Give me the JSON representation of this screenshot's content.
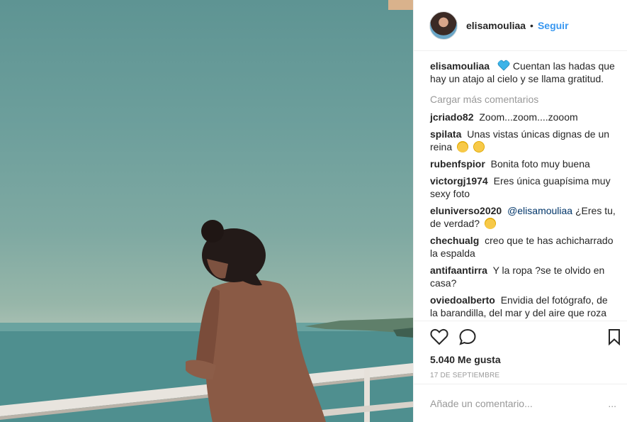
{
  "photo": {
    "alt_icon": "photo-balcony-sea"
  },
  "header": {
    "username": "elisamouliaa",
    "separator": "•",
    "follow_label": "Seguir"
  },
  "caption": {
    "username": "elisamouliaa",
    "emoji_icon": "blue-heart-icon",
    "text": "Cuentan las hadas que hay un atajo al cielo y se llama gratitud."
  },
  "load_more_label": "Cargar más comentarios",
  "comments": [
    {
      "user": "jcriado82",
      "text": "Zoom...zoom....zooom"
    },
    {
      "user": "spilata",
      "text": "Unas vistas únicas dignas de un reina",
      "emojis": [
        "scream-face-emoji",
        "kiss-face-emoji"
      ]
    },
    {
      "user": "rubenfspior",
      "text": "Bonita foto muy buena"
    },
    {
      "user": "victorgj1974",
      "text": "Eres única guapísima muy sexy foto"
    },
    {
      "user": "eluniverso2020",
      "mention": "@elisamouliaa",
      "text": " ¿Eres tu, de verdad?",
      "emojis": [
        "thinking-face-emoji"
      ]
    },
    {
      "user": "chechualg",
      "text": "creo que te has achicharrado la espalda"
    },
    {
      "user": "antifaantirra",
      "text": "Y la ropa ?se te olvido en casa?"
    },
    {
      "user": "oviedoalberto",
      "text": "Envidia del fotógrafo, de la barandilla, del mar y del aire que roza tu"
    }
  ],
  "actions": {
    "likes": "5.040 Me gusta",
    "date": "17 DE SEPTIEMBRE"
  },
  "add_comment": {
    "placeholder": "Añade un comentario...",
    "more": "..."
  },
  "colors": {
    "link": "#3897f0",
    "mention": "#003569",
    "muted": "#999999",
    "heart_emoji": "#3bb3e8"
  }
}
